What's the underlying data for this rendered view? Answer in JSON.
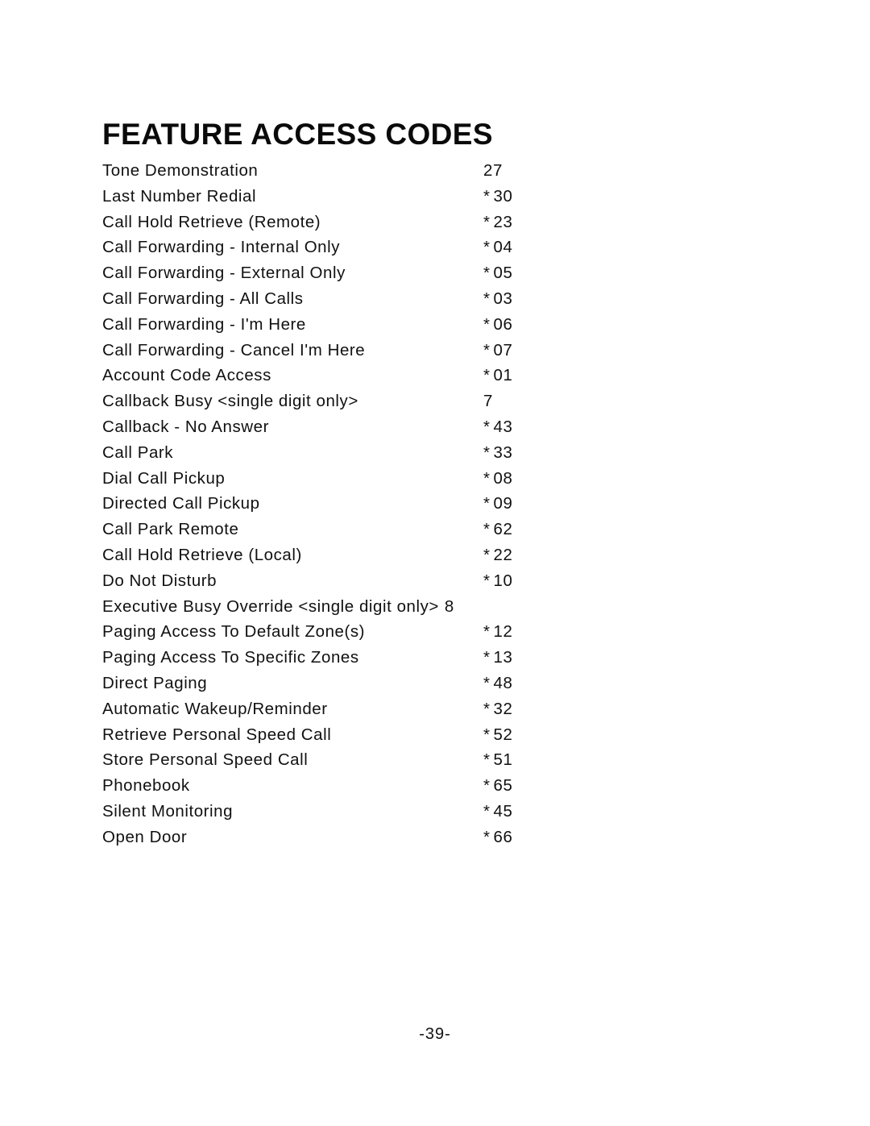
{
  "document": {
    "title": "FEATURE ACCESS CODES",
    "page_number": "-39-"
  },
  "codes": [
    {
      "label": "Tone Demonstration",
      "star": "",
      "number": "27",
      "inline": false
    },
    {
      "label": "Last Number Redial",
      "star": "*",
      "number": "30",
      "inline": false
    },
    {
      "label": "Call Hold Retrieve (Remote)",
      "star": "*",
      "number": "23",
      "inline": false
    },
    {
      "label": "Call Forwarding - Internal Only",
      "star": "*",
      "number": "04",
      "inline": false
    },
    {
      "label": "Call Forwarding - External Only",
      "star": "*",
      "number": "05",
      "inline": false
    },
    {
      "label": "Call Forwarding - All Calls",
      "star": "*",
      "number": "03",
      "inline": false
    },
    {
      "label": "Call Forwarding - I'm Here",
      "star": "*",
      "number": "06",
      "inline": false
    },
    {
      "label": "Call Forwarding - Cancel I'm Here",
      "star": "*",
      "number": "07",
      "inline": false
    },
    {
      "label": "Account Code Access",
      "star": "*",
      "number": "01",
      "inline": false
    },
    {
      "label": "Callback Busy <single digit only>",
      "star": "",
      "number": "7",
      "inline": false
    },
    {
      "label": "Callback - No Answer",
      "star": "*",
      "number": "43",
      "inline": false
    },
    {
      "label": "Call Park",
      "star": "*",
      "number": "33",
      "inline": false
    },
    {
      "label": "Dial Call Pickup",
      "star": "*",
      "number": "08",
      "inline": false
    },
    {
      "label": "Directed Call Pickup",
      "star": "*",
      "number": "09",
      "inline": false
    },
    {
      "label": "Call Park Remote",
      "star": "*",
      "number": "62",
      "inline": false
    },
    {
      "label": "Call Hold Retrieve (Local)",
      "star": "*",
      "number": "22",
      "inline": false
    },
    {
      "label": "Do Not Disturb",
      "star": "*",
      "number": "10",
      "inline": false
    },
    {
      "label": "Executive Busy Override <single digit only>",
      "star": "",
      "number": "8",
      "inline": true
    },
    {
      "label": "Paging Access To Default Zone(s)",
      "star": "*",
      "number": "12",
      "inline": false
    },
    {
      "label": "Paging Access To Specific Zones",
      "star": "*",
      "number": "13",
      "inline": false
    },
    {
      "label": "Direct Paging",
      "star": "*",
      "number": "48",
      "inline": false
    },
    {
      "label": "Automatic Wakeup/Reminder",
      "star": "*",
      "number": "32",
      "inline": false
    },
    {
      "label": "Retrieve Personal Speed Call",
      "star": "*",
      "number": "52",
      "inline": false
    },
    {
      "label": "Store Personal Speed Call",
      "star": "*",
      "number": "51",
      "inline": false
    },
    {
      "label": "Phonebook",
      "star": "*",
      "number": "65",
      "inline": false
    },
    {
      "label": "Silent Monitoring",
      "star": "*",
      "number": "45",
      "inline": false
    },
    {
      "label": "Open Door",
      "star": "*",
      "number": "66",
      "inline": false
    }
  ]
}
